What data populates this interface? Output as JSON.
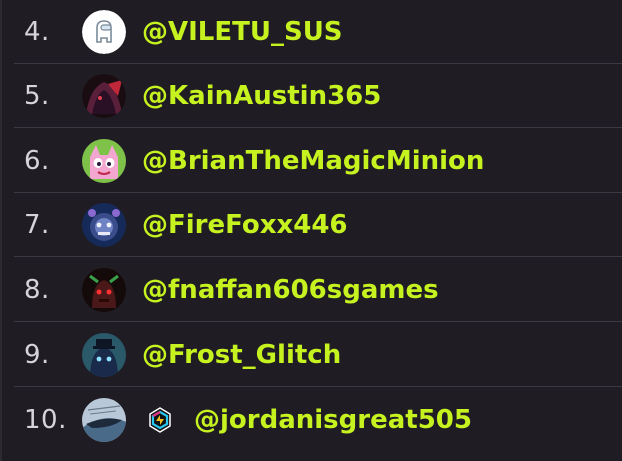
{
  "leaderboard": {
    "rows": [
      {
        "rank": "4.",
        "username": "@VILETU_SUS"
      },
      {
        "rank": "5.",
        "username": "@KainAustin365"
      },
      {
        "rank": "6.",
        "username": "@BrianTheMagicMinion"
      },
      {
        "rank": "7.",
        "username": "@FireFoxx446"
      },
      {
        "rank": "8.",
        "username": "@fnaffan606sgames"
      },
      {
        "rank": "9.",
        "username": "@Frost_Glitch"
      },
      {
        "rank": "10.",
        "username": "@jordanisgreat505"
      }
    ]
  },
  "colors": {
    "background": "#1f1c23",
    "username": "#c6f21f",
    "rank": "#d6d3da",
    "divider": "#3b3841"
  }
}
